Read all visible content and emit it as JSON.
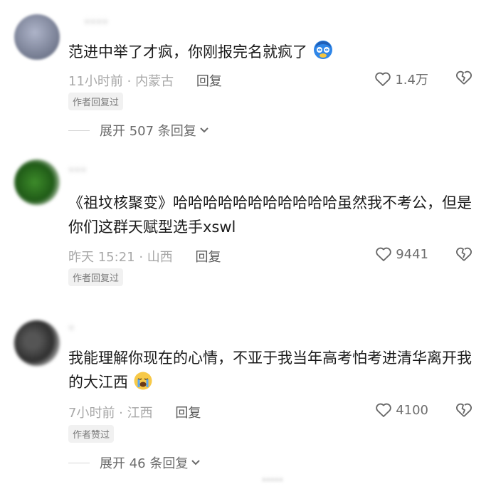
{
  "comments": [
    {
      "username": "**** ",
      "text": "范进中举了才疯，你刚报完名就疯了",
      "time_location": "11小时前 · 内蒙古",
      "reply": "回复",
      "likes": "1.4万",
      "badge": "作者回复过",
      "expand": "展开 507 条回复",
      "emoji_icon": "dizzy-face-emoji-icon"
    },
    {
      "username": "***",
      "text": "《祖坟核聚变》哈哈哈哈哈哈哈哈哈哈哈虽然我不考公，但是你们这群天赋型选手xswl",
      "time_location": "昨天 15:21 · 山西",
      "reply": "回复",
      "likes": "9441",
      "badge": "作者回复过"
    },
    {
      "username": "*",
      "text": "我能理解你现在的心情，不亚于我当年高考怕考进清华离开我的大江西",
      "time_location": "7小时前 · 江西",
      "reply": "回复",
      "likes": "4100",
      "badge": "作者赞过",
      "expand": "展开 46 条回复",
      "emoji_icon": "crying-face-emoji-icon"
    }
  ],
  "watermark": "*****"
}
